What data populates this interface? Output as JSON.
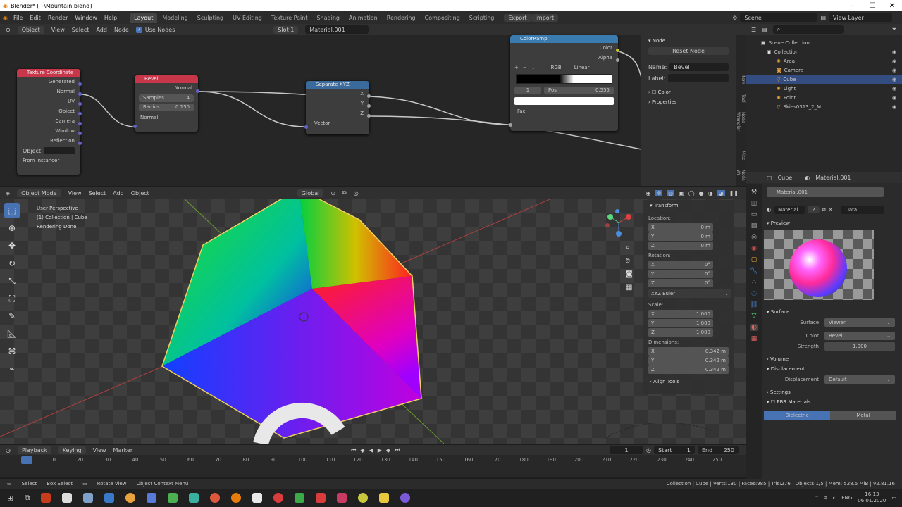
{
  "window": {
    "title": "Blender* [~\\Mountain.blend]"
  },
  "menu": [
    "File",
    "Edit",
    "Render",
    "Window",
    "Help"
  ],
  "workspaces": [
    "Layout",
    "Modeling",
    "Sculpting",
    "UV Editing",
    "Texture Paint",
    "Shading",
    "Animation",
    "Rendering",
    "Compositing",
    "Scripting"
  ],
  "active_workspace": "Layout",
  "export_label": "Export",
  "import_label": "Import",
  "scene": "Scene",
  "view_layer": "View Layer",
  "node_header": {
    "object_mode": "Object",
    "items": [
      "View",
      "Select",
      "Add",
      "Node"
    ],
    "use_nodes": "Use Nodes",
    "slot": "Slot 1",
    "material": "Material.001"
  },
  "nodes": {
    "texcoord": {
      "title": "Texture Coordinate",
      "outputs": [
        "Generated",
        "Normal",
        "UV",
        "Object",
        "Camera",
        "Window",
        "Reflection"
      ],
      "object_label": "Object",
      "from_instancer": "From Instancer"
    },
    "bevel": {
      "title": "Bevel",
      "output": "Normal",
      "samples_label": "Samples",
      "samples": "4",
      "radius_label": "Radius",
      "radius": "0.150",
      "input": "Normal"
    },
    "separate": {
      "title": "Separate XYZ",
      "outputs": [
        "X",
        "Y",
        "Z"
      ],
      "input": "Vector"
    },
    "colorramp": {
      "title": "ColorRamp",
      "outputs": [
        "Color",
        "Alpha"
      ],
      "mode": "RGB",
      "interp": "Linear",
      "index": "1",
      "pos_label": "Pos",
      "pos": "0.555",
      "input": "Fac"
    }
  },
  "node_sidebar": {
    "section": "Node",
    "reset": "Reset Node",
    "name_label": "Name:",
    "name": "Bevel",
    "label_label": "Label:",
    "color": "Color",
    "properties": "Properties",
    "tabs": [
      "Item",
      "Tool",
      "Node Wrangler",
      "Misc",
      "Node Wr"
    ]
  },
  "outliner": {
    "root": "Scene Collection",
    "items": [
      "Collection",
      "Area",
      "Camera",
      "Cube",
      "Light",
      "Point",
      "Skies0313_2_M"
    ]
  },
  "viewport_header": {
    "mode": "Object Mode",
    "items": [
      "View",
      "Select",
      "Add",
      "Object"
    ],
    "orientation": "Global"
  },
  "viewport_info": [
    "User Perspective",
    "(1) Collection | Cube",
    "Rendering Done"
  ],
  "transform": {
    "title": "Transform",
    "location_label": "Location:",
    "location": [
      {
        "axis": "X",
        "value": "0 m"
      },
      {
        "axis": "Y",
        "value": "0 m"
      },
      {
        "axis": "Z",
        "value": "0 m"
      }
    ],
    "rotation_label": "Rotation:",
    "rotation": [
      {
        "axis": "X",
        "value": "0°"
      },
      {
        "axis": "Y",
        "value": "0°"
      },
      {
        "axis": "Z",
        "value": "0°"
      }
    ],
    "euler": "XYZ Euler",
    "scale_label": "Scale:",
    "scale": [
      {
        "axis": "X",
        "value": "1.000"
      },
      {
        "axis": "Y",
        "value": "1.000"
      },
      {
        "axis": "Z",
        "value": "1.000"
      }
    ],
    "dimensions_label": "Dimensions:",
    "dimensions": [
      {
        "axis": "X",
        "value": "0.342 m"
      },
      {
        "axis": "Y",
        "value": "0.342 m"
      },
      {
        "axis": "Z",
        "value": "0.342 m"
      }
    ],
    "align_tools": "Align Tools"
  },
  "timeline": {
    "menus": [
      "Playback",
      "Keying",
      "View",
      "Marker"
    ],
    "current": "1",
    "start_label": "Start",
    "start": "1",
    "end_label": "End",
    "end": "250",
    "ticks": [
      "10",
      "20",
      "30",
      "40",
      "50",
      "60",
      "70",
      "80",
      "90",
      "100",
      "110",
      "120",
      "130",
      "140",
      "150",
      "160",
      "170",
      "180",
      "190",
      "200",
      "210",
      "220",
      "230",
      "240",
      "250"
    ]
  },
  "status": {
    "select": "Select",
    "box_select": "Box Select",
    "rotate": "Rotate View",
    "context": "Object Context Menu",
    "stats": "Collection | Cube | Verts:130 | Faces:985 | Tris:276 | Objects:1/5 | Mem: 528.5 MiB | v2.81.16"
  },
  "properties": {
    "object": "Cube",
    "material": "Material.001",
    "slot_material": "Material.001",
    "slot_label": "Material",
    "users": "2",
    "data": "Data",
    "preview": "Preview",
    "surface_section": "Surface",
    "surface_label": "Surface",
    "surface": "Viewer",
    "color_label": "Color",
    "color": "Bevel",
    "strength_label": "Strength",
    "strength": "1.000",
    "volume": "Volume",
    "displacement_section": "Displacement",
    "displacement_label": "Displacement",
    "displacement": "Default",
    "settings": "Settings",
    "pbr": "PBR Materials",
    "dielectric": "Dielectric",
    "metal": "Metal"
  },
  "taskbar": {
    "lang": "ENG",
    "time": "16:13",
    "date": "06.01.2020"
  },
  "colors": {
    "accent": "#4772b3",
    "texcoord_header": "#c8364a",
    "bevel_header": "#c8364a",
    "separate_header": "#3a6b9c",
    "colorramp_header": "#3a7bb0"
  }
}
